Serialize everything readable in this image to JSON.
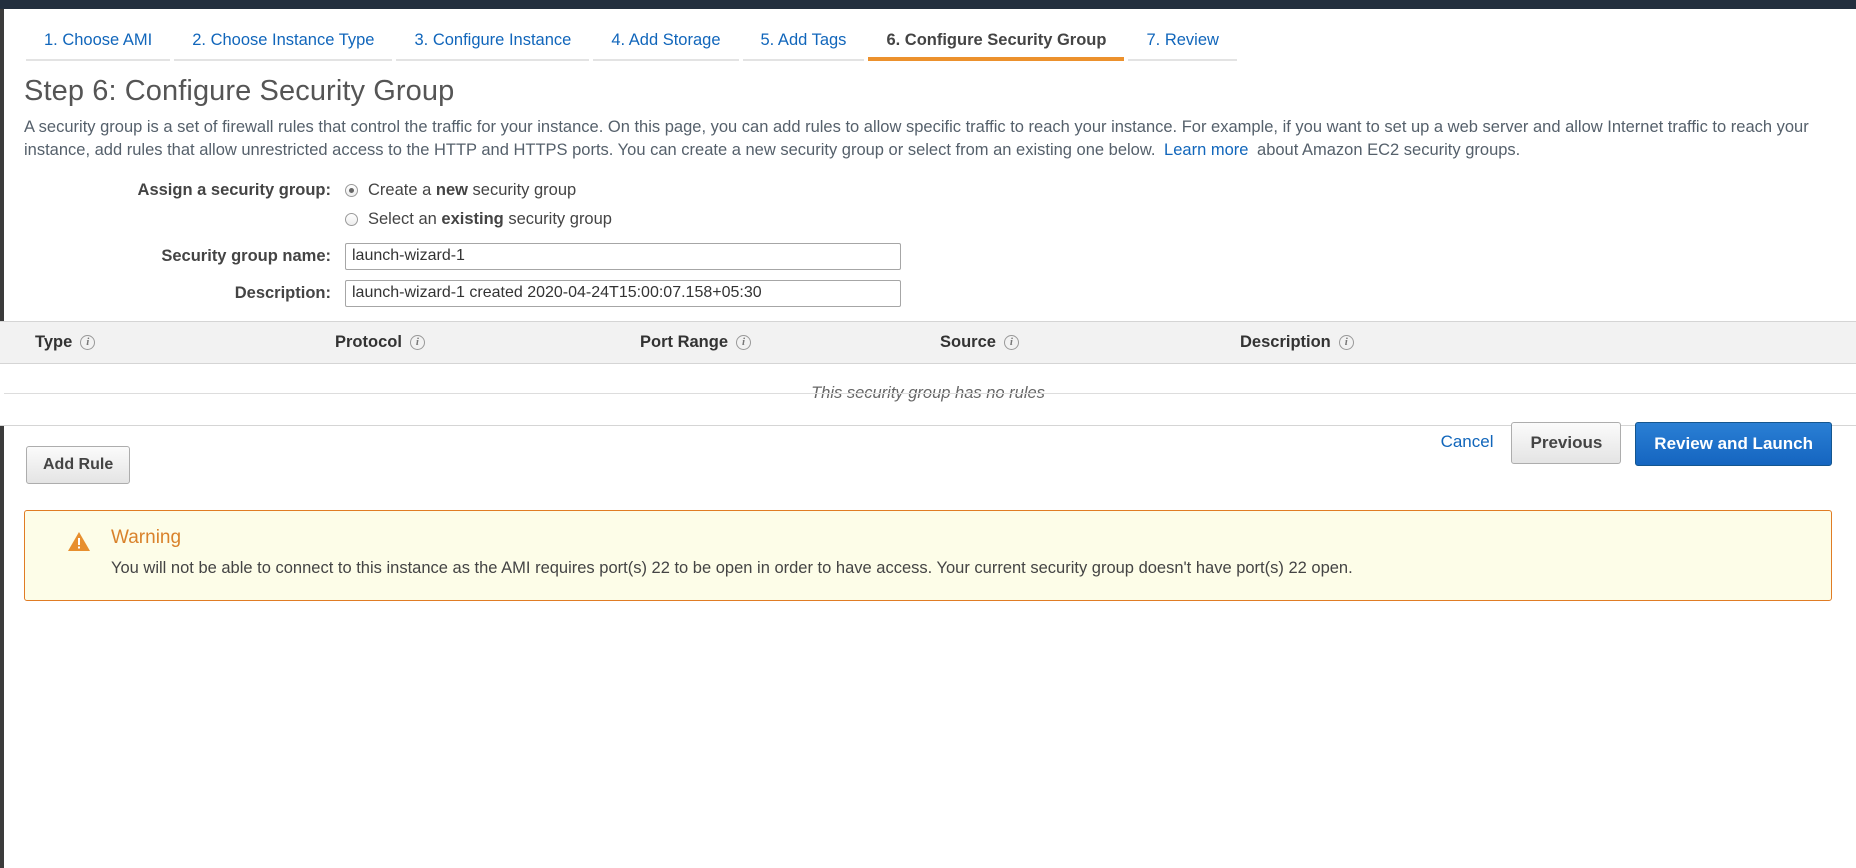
{
  "wizard": {
    "tabs": [
      {
        "label": "1. Choose AMI",
        "active": false
      },
      {
        "label": "2. Choose Instance Type",
        "active": false
      },
      {
        "label": "3. Configure Instance",
        "active": false
      },
      {
        "label": "4. Add Storage",
        "active": false
      },
      {
        "label": "5. Add Tags",
        "active": false
      },
      {
        "label": "6. Configure Security Group",
        "active": true
      },
      {
        "label": "7. Review",
        "active": false
      }
    ],
    "active_tab_color": "#ec912d",
    "link_color": "#1166bb"
  },
  "page": {
    "heading": "Step 6: Configure Security Group",
    "intro_part1": "A security group is a set of firewall rules that control the traffic for your instance. On this page, you can add rules to allow specific traffic to reach your instance. For example, if you want to set up a web server and allow Internet traffic to reach your instance, add rules that allow unrestricted access to the HTTP and HTTPS ports. You can create a new security group or select from an existing one below.",
    "learn_more": "Learn more",
    "intro_part2": "about Amazon EC2 security groups."
  },
  "form": {
    "assign_label": "Assign a security group:",
    "option_new_prefix": "Create a ",
    "option_new_bold": "new",
    "option_new_suffix": " security group",
    "option_existing_prefix": "Select an ",
    "option_existing_bold": "existing",
    "option_existing_suffix": " security group",
    "name_label": "Security group name:",
    "name_value": "launch-wizard-1",
    "description_label": "Description:",
    "description_value": "launch-wizard-1 created 2020-04-24T15:00:07.158+05:30"
  },
  "rules_table": {
    "columns": [
      "Type",
      "Protocol",
      "Port Range",
      "Source",
      "Description"
    ],
    "rows": [],
    "empty_message": "This security group has no rules",
    "info_glyph": "i"
  },
  "actions": {
    "add_rule": "Add Rule"
  },
  "warning": {
    "icon": "warning-triangle-icon",
    "title": "Warning",
    "message": "You will not be able to connect to this instance as the AMI requires port(s) 22 to be open in order to have access. Your current security group doesn't have port(s) 22 open.",
    "border_color": "#e07c24",
    "background_color": "#fdfde8"
  },
  "footer": {
    "cancel": "Cancel",
    "previous": "Previous",
    "review_and_launch": "Review and Launch",
    "primary_color": "#1565c0"
  }
}
